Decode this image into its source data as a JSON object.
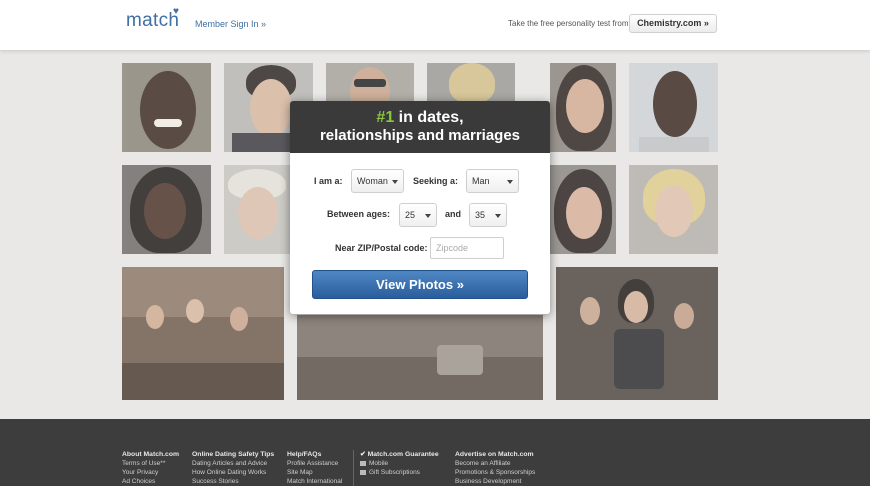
{
  "header": {
    "logo_text": "match",
    "signin": "Member Sign In »",
    "promo": "Take the free personality test from",
    "chemistry_button": "Chemistry.com »"
  },
  "card": {
    "headline_num": "#1",
    "headline_rest": " in dates,",
    "headline_line2": "relationships and marriages",
    "iam_label": "I am a:",
    "iam_value": "Woman",
    "seeking_label": "Seeking a:",
    "seeking_value": "Man",
    "ages_label": "Between ages:",
    "age_min": "25",
    "ages_and": "and",
    "age_max": "35",
    "zip_label": "Near ZIP/Postal code:",
    "zip_placeholder": "Zipcode",
    "view_button": "View Photos »"
  },
  "footer": {
    "columns": [
      {
        "heading": "About Match.com",
        "items": [
          "Terms of Use**",
          "Your Privacy",
          "Ad Choices"
        ]
      },
      {
        "heading": "Online Dating Safety Tips",
        "items": [
          "Dating Articles and Advice",
          "How Online Dating Works",
          "Success Stories"
        ]
      },
      {
        "heading": "Help/FAQs",
        "items": [
          "Profile Assistance",
          "Site Map",
          "Match International"
        ]
      },
      {
        "heading": "Match.com Guarantee",
        "items": [
          "Mobile",
          "Gift Subscriptions"
        ]
      },
      {
        "heading": "Advertise on Match.com",
        "items": [
          "Become an Affiliate",
          "Promotions & Sponsorships",
          "Business Development"
        ]
      }
    ]
  },
  "colors": {
    "brand_blue": "#3f6fa3",
    "accent_green": "#8cc63f",
    "button_blue": "#2a5d9c",
    "footer_bg": "#3d3d3d"
  }
}
